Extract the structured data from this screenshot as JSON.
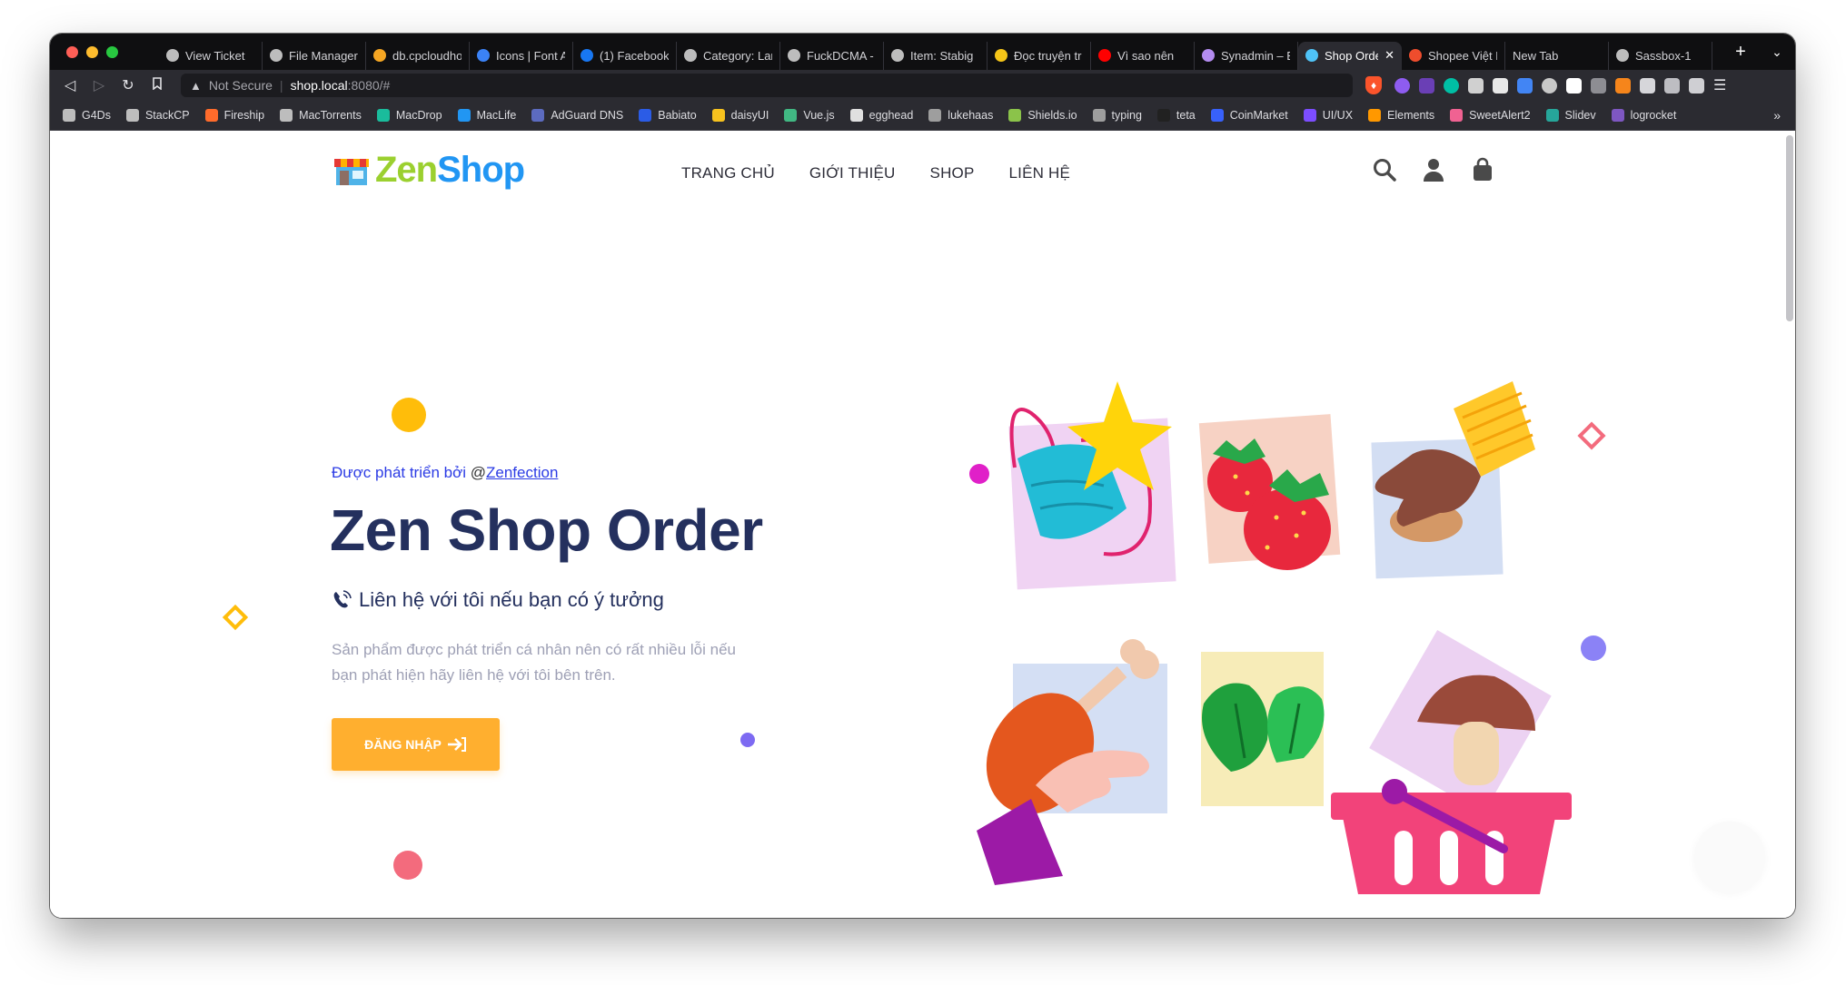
{
  "browser": {
    "tabs": [
      {
        "title": "View Ticket",
        "icon": "globe-icon",
        "color": "#bdbdbd"
      },
      {
        "title": "File Manager",
        "icon": "globe-icon",
        "color": "#bdbdbd"
      },
      {
        "title": "db.cpcloudho",
        "icon": "db-icon",
        "color": "#f5a623"
      },
      {
        "title": "Icons | Font A",
        "icon": "flag-icon",
        "color": "#3b82f6"
      },
      {
        "title": "(1) Facebook",
        "icon": "facebook-icon",
        "color": "#1877f2"
      },
      {
        "title": "Category: Lar",
        "icon": "globe-icon",
        "color": "#bdbdbd"
      },
      {
        "title": "FuckDCMA -",
        "icon": "globe-icon",
        "color": "#bdbdbd"
      },
      {
        "title": "Item: Stabig",
        "icon": "globe-icon",
        "color": "#bdbdbd"
      },
      {
        "title": "Đọc truyện tr",
        "icon": "n-icon",
        "color": "#f5c518"
      },
      {
        "title": "Vì sao nên",
        "icon": "youtube-icon",
        "color": "#ff0000"
      },
      {
        "title": "Synadmin – E",
        "icon": "synadmin-icon",
        "color": "#b48cf0"
      },
      {
        "title": "Shop Orde",
        "icon": "shop-icon",
        "color": "#4fc3f7"
      },
      {
        "title": "Shopee Việt N",
        "icon": "shopee-icon",
        "color": "#ee4d2d"
      },
      {
        "title": "New Tab",
        "icon": "",
        "color": ""
      },
      {
        "title": "Sassbox-1",
        "icon": "globe-icon",
        "color": "#bdbdbd"
      }
    ],
    "active_tab_index": 11,
    "address": {
      "warning": "Not Secure",
      "host": "shop.local",
      "path": ":8080/#"
    },
    "bookmarks": [
      {
        "label": "G4Ds",
        "color": "#bdbdbd"
      },
      {
        "label": "StackCP",
        "color": "#bdbdbd"
      },
      {
        "label": "Fireship",
        "color": "#ff6b2b"
      },
      {
        "label": "MacTorrents",
        "color": "#bdbdbd"
      },
      {
        "label": "MacDrop",
        "color": "#1abc9c"
      },
      {
        "label": "MacLife",
        "color": "#2196f3"
      },
      {
        "label": "AdGuard DNS",
        "color": "#5c6bc0"
      },
      {
        "label": "Babiato",
        "color": "#2b5ce6"
      },
      {
        "label": "daisyUI",
        "color": "#f7c21e"
      },
      {
        "label": "Vue.js",
        "color": "#41b883"
      },
      {
        "label": "egghead",
        "color": "#e0e0e0"
      },
      {
        "label": "lukehaas",
        "color": "#9e9e9e"
      },
      {
        "label": "Shields.io",
        "color": "#8bc34a"
      },
      {
        "label": "typing",
        "color": "#9e9e9e"
      },
      {
        "label": "teta",
        "color": "#212121"
      },
      {
        "label": "CoinMarket",
        "color": "#3861fb"
      },
      {
        "label": "UI/UX",
        "color": "#7c4dff"
      },
      {
        "label": "Elements",
        "color": "#ff9800"
      },
      {
        "label": "SweetAlert2",
        "color": "#f06292"
      },
      {
        "label": "Slidev",
        "color": "#26a69a"
      },
      {
        "label": "logrocket",
        "color": "#7e57c2"
      }
    ],
    "bookmarks_more": "»"
  },
  "site": {
    "logo": {
      "zen": "Zen",
      "shop": "Shop"
    },
    "nav": [
      "TRANG CHỦ",
      "GIỚI THIỆU",
      "SHOP",
      "LIÊN HỆ"
    ],
    "hero": {
      "credit_prefix": "Được phát triển bởi",
      "credit_at": "@",
      "credit_link": "Zenfection",
      "title": "Zen Shop Order",
      "contact": "Liên hệ với tôi nếu bạn có ý tưởng",
      "description": "Sản phẩm được phát triển cá nhân nên có rất nhiều lỗi nếu bạn phát hiện hãy liên hệ với tôi bên trên.",
      "button": "ĐĂNG NHẬP"
    },
    "colors": {
      "accent": "#ffaf2f",
      "title": "#24305e",
      "link": "#2b3be5",
      "muted": "#9ea0b5"
    }
  }
}
